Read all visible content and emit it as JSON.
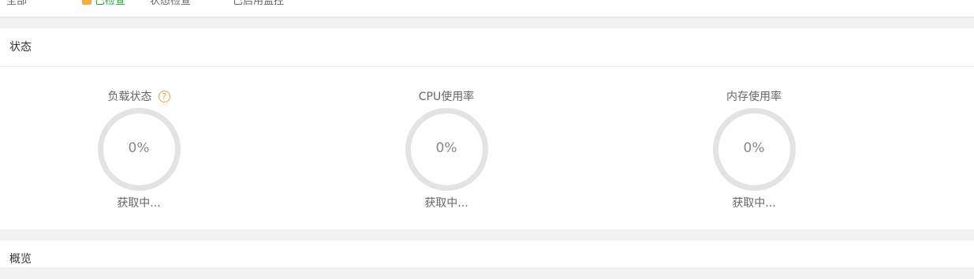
{
  "topbar": {
    "crumbs": [
      "全部",
      "已检查",
      "状态检查",
      "已启用监控"
    ]
  },
  "status_panel": {
    "title": "状态",
    "gauges": [
      {
        "title": "负载状态",
        "value": "0%",
        "status": "获取中...",
        "help_icon": "question-circle-icon"
      },
      {
        "title": "CPU使用率",
        "value": "0%",
        "status": "获取中..."
      },
      {
        "title": "内存使用率",
        "value": "0%",
        "status": "获取中..."
      }
    ]
  },
  "overview_panel": {
    "title": "概览"
  },
  "colors": {
    "accent_green": "#20a53a",
    "help_orange": "#e8a23b",
    "ring_track": "#e3e3e3"
  }
}
